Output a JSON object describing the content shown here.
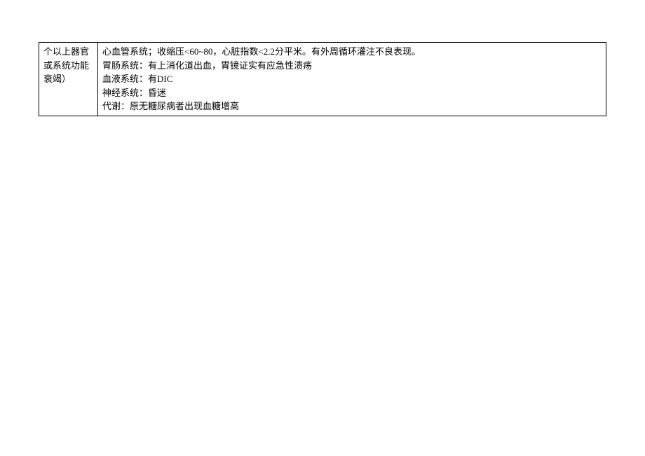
{
  "table": {
    "left": {
      "line1": "个以上器官",
      "line2": "或系统功能",
      "line3": "衰竭）"
    },
    "right": {
      "line1": "心血管系统；收缩压<60~80，心脏指数<2.2分平米。有外周循环灌注不良表现。",
      "line2": "胃肠系统：有上消化道出血，胃镜证实有应急性溃疡",
      "line3": "血液系统：有DIC",
      "line4": "神经系统：昏迷",
      "line5": "代谢：原无糖尿病者出现血糖增高"
    }
  }
}
